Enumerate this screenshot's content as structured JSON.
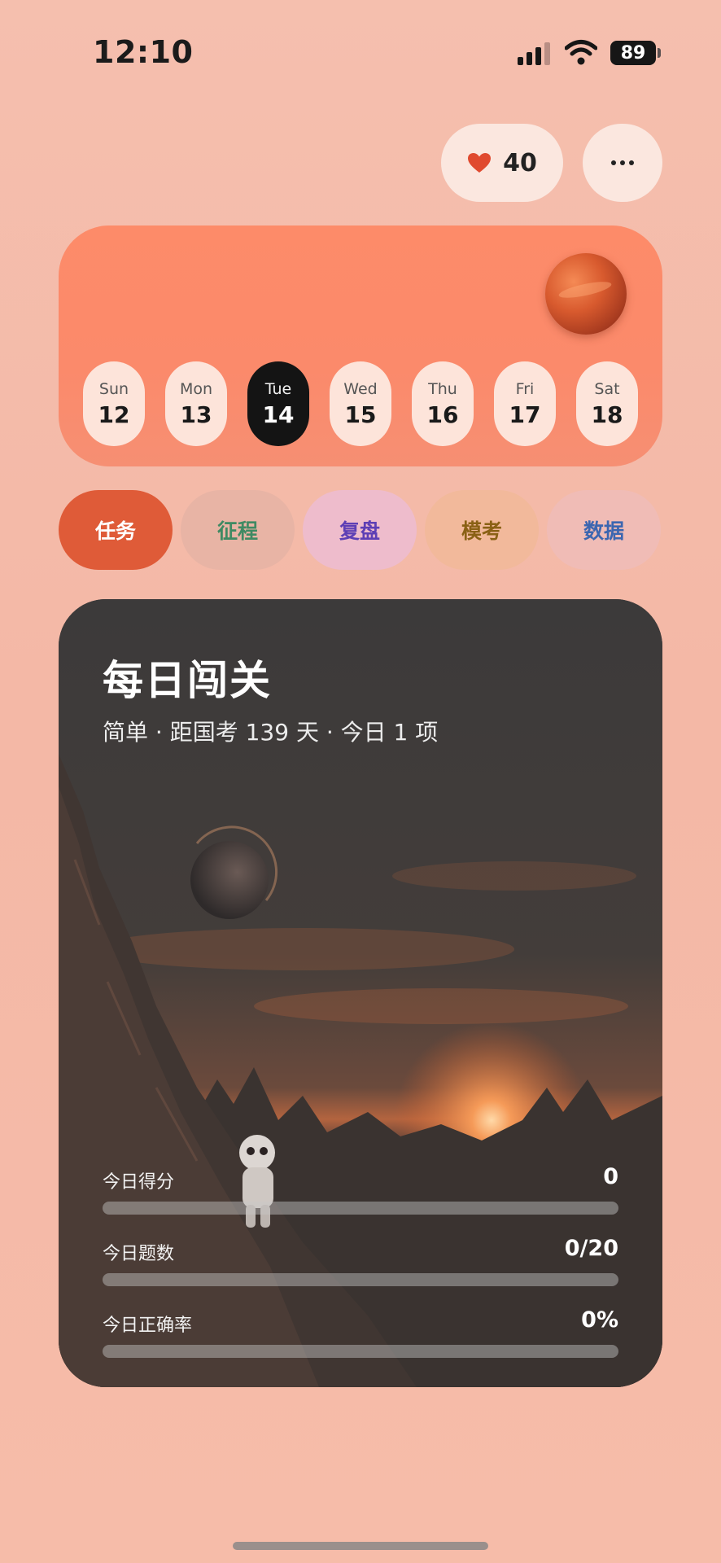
{
  "status_bar": {
    "time": "12:10",
    "battery": "89"
  },
  "header": {
    "likes": "40",
    "icons": [
      "heart-icon",
      "more-icon"
    ]
  },
  "calendar": {
    "planet_icon": "mars-planet-icon",
    "days": [
      {
        "name": "Sun",
        "num": "12",
        "active": false
      },
      {
        "name": "Mon",
        "num": "13",
        "active": false
      },
      {
        "name": "Tue",
        "num": "14",
        "active": true
      },
      {
        "name": "Wed",
        "num": "15",
        "active": false
      },
      {
        "name": "Thu",
        "num": "16",
        "active": false
      },
      {
        "name": "Fri",
        "num": "17",
        "active": false
      },
      {
        "name": "Sat",
        "num": "18",
        "active": false
      }
    ]
  },
  "tabs": [
    {
      "label": "任务",
      "active": true
    },
    {
      "label": "征程",
      "active": false
    },
    {
      "label": "复盘",
      "active": false
    },
    {
      "label": "模考",
      "active": false
    },
    {
      "label": "数据",
      "active": false
    }
  ],
  "challenge": {
    "title": "每日闯关",
    "subtitle": "简单 · 距国考 139 天 · 今日 1 项",
    "stats": [
      {
        "label": "今日得分",
        "value": "0",
        "progress": 0
      },
      {
        "label": "今日题数",
        "value": "0/20",
        "progress": 0
      },
      {
        "label": "今日正确率",
        "value": "0%",
        "progress": 0
      }
    ]
  },
  "colors": {
    "accent": "#df5b38",
    "calendar_bg": "#fb8a6b",
    "active_day": "#141414"
  }
}
